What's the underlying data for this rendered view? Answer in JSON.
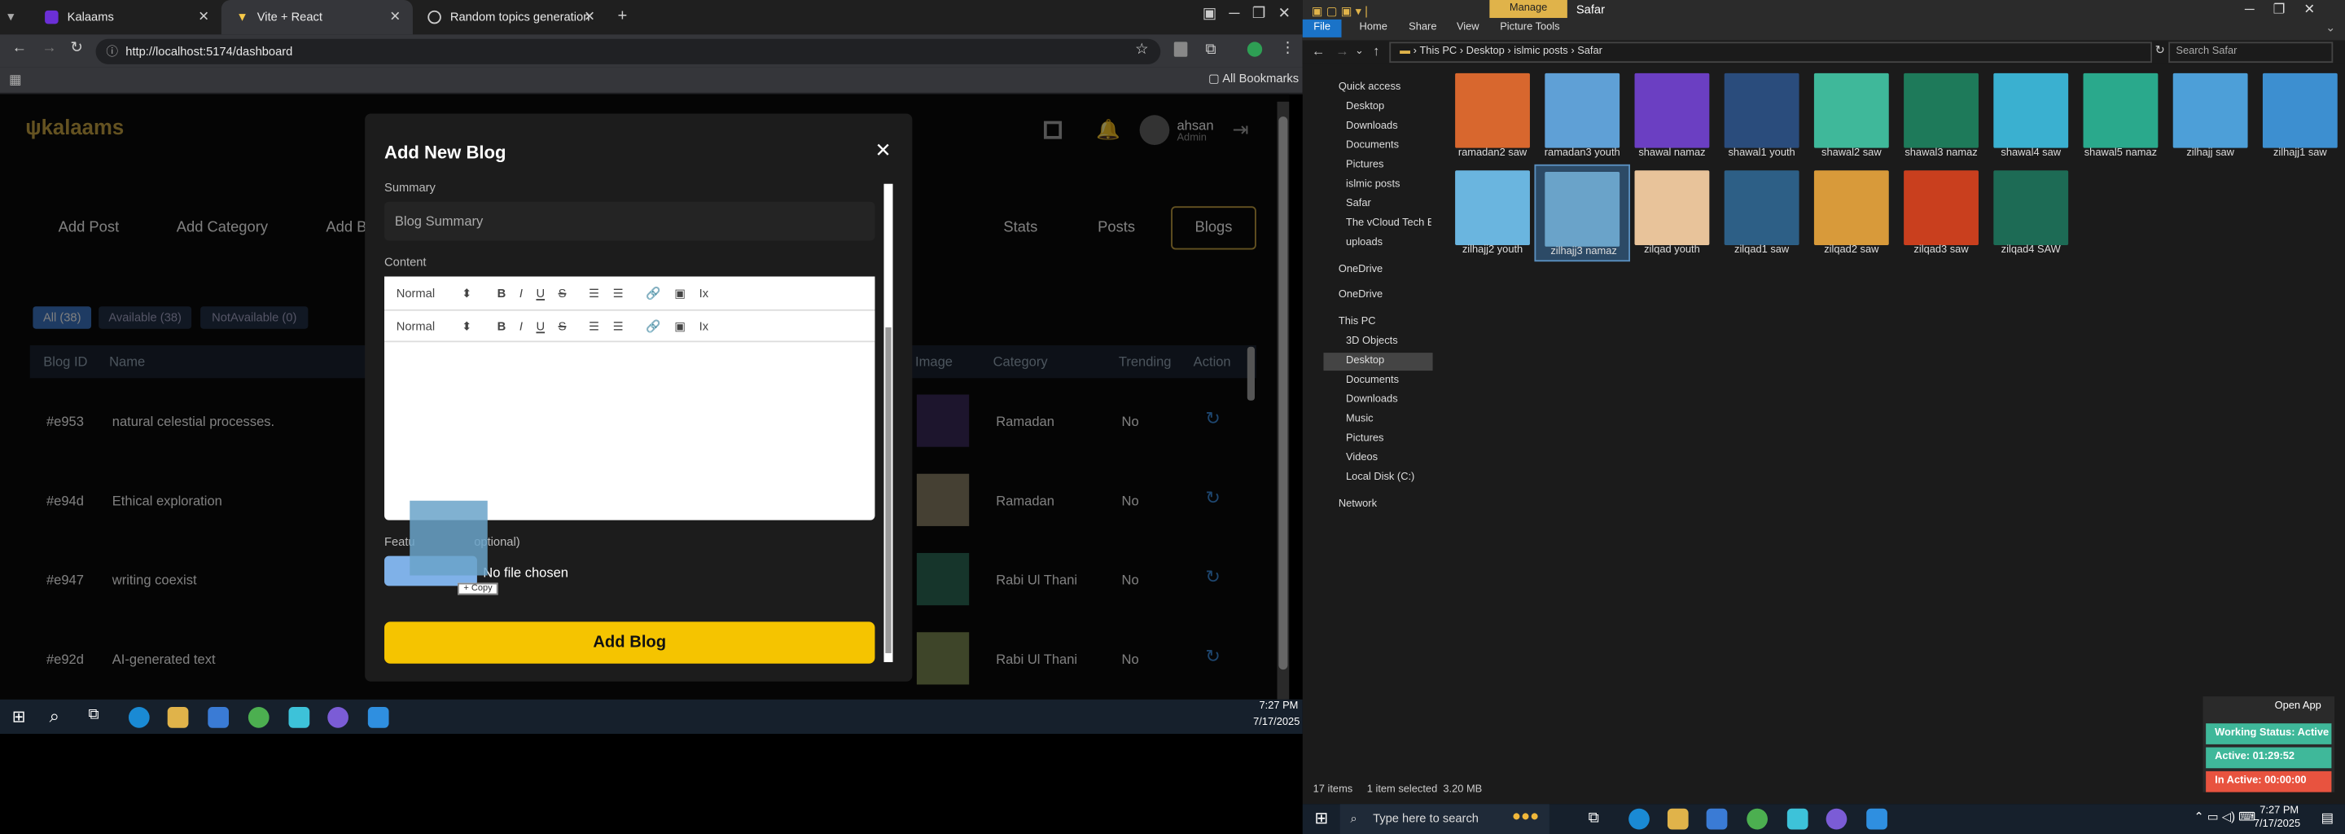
{
  "browser": {
    "tabs": [
      {
        "label": "Kalaams"
      },
      {
        "label": "Vite + React"
      },
      {
        "label": "Random topics generation"
      }
    ],
    "url": "http://localhost:5174/dashboard",
    "bookmarks_label": "All Bookmarks"
  },
  "app": {
    "logo": "kalaams",
    "user_name": "ahsan",
    "user_role": "Admin",
    "top_nav": [
      "Add Post",
      "Add Category",
      "Add Bl",
      "Stats",
      "Posts",
      "Blogs"
    ],
    "filters": [
      "All (38)",
      "Available (38)",
      "NotAvailable (0)"
    ],
    "columns": [
      "Blog ID",
      "Name",
      "Image",
      "Category",
      "Trending",
      "Action"
    ],
    "rows": [
      {
        "id": "#e953",
        "name": "natural celestial processes.",
        "category": "Ramadan",
        "trending": "No"
      },
      {
        "id": "#e94d",
        "name": "Ethical exploration",
        "category": "Ramadan",
        "trending": "No"
      },
      {
        "id": "#e947",
        "name": "writing coexist",
        "category": "Rabi Ul Thani",
        "trending": "No"
      },
      {
        "id": "#e92d",
        "name": "AI-generated text",
        "category": "Rabi Ul Thani",
        "trending": "No"
      }
    ]
  },
  "modal": {
    "title": "Add New Blog",
    "summary_label": "Summary",
    "summary_placeholder": "Blog Summary",
    "content_label": "Content",
    "format": "Normal",
    "featured_label_a": "Featu",
    "featured_label_b": "optional)",
    "no_file": "No file chosen",
    "copy": "Copy",
    "submit": "Add Blog"
  },
  "taskbar_left": {
    "time": "7:27 PM",
    "date": "7/17/2025"
  },
  "explorer": {
    "ribbon_title": "Manage",
    "folder_title": "Safar",
    "menu": [
      "File",
      "Home",
      "Share",
      "View",
      "Picture Tools"
    ],
    "breadcrumb": [
      "This PC",
      "Desktop",
      "islmic posts",
      "Safar"
    ],
    "search_placeholder": "Search Safar",
    "nav": [
      "Quick access",
      "Desktop",
      "Downloads",
      "Documents",
      "Pictures",
      "islmic posts",
      "Safar",
      "The vCloud Tech Bl",
      "uploads",
      "OneDrive",
      "OneDrive",
      "This PC",
      "3D Objects",
      "Desktop",
      "Documents",
      "Downloads",
      "Music",
      "Pictures",
      "Videos",
      "Local Disk (C:)",
      "Network"
    ],
    "files": [
      "ramadan2 saw",
      "ramadan3 youth",
      "shawal namaz",
      "shawal1 youth",
      "shawal2 saw",
      "shawal3 namaz",
      "shawal4 saw",
      "shawal5 namaz",
      "zilhajj saw",
      "zilhajj1 saw",
      "zilhajj2 youth",
      "zilhajj3 namaz",
      "zilqad youth",
      "zilqad1 saw",
      "zilqad2 saw",
      "zilqad3 saw",
      "zilqad4 SAW"
    ],
    "status_items": "17 items",
    "status_sel": "1 item selected  3.20 MB"
  },
  "widget": {
    "open": "Open App",
    "working": "Working Status: Active",
    "active": "Active: 01:29:52",
    "inactive": "In Active: 00:00:00"
  },
  "taskbar_right": {
    "search": "Type here to search",
    "time": "7:27 PM",
    "date": "7/17/2025"
  }
}
